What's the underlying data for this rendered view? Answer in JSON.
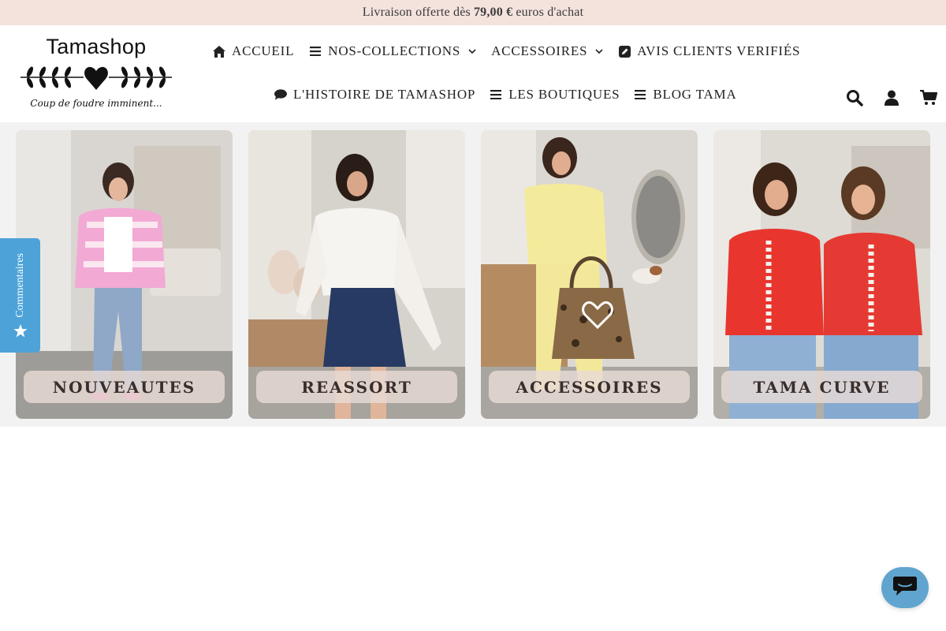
{
  "announcement": {
    "prefix": "Livraison offerte dès",
    "amount": "79,00 €",
    "suffix": "euros d'achat"
  },
  "logo": {
    "title": "Tamashop",
    "tagline": "Coup de foudre imminent..."
  },
  "nav": {
    "row1": [
      {
        "label": "ACCUEIL",
        "icon": "home-icon"
      },
      {
        "label": "NOS-COLLECTIONS",
        "icon": "bars-icon",
        "dropdown": true
      },
      {
        "label": "ACCESSOIRES",
        "dropdown": true
      },
      {
        "label": "AVIS CLIENTS VERIFIÉS",
        "icon": "edit-icon"
      }
    ],
    "row2": [
      {
        "label": "L'HISTOIRE DE TAMASHOP",
        "icon": "comment-icon"
      },
      {
        "label": "LES BOUTIQUES",
        "icon": "bars-icon"
      },
      {
        "label": "BLOG TAMA",
        "icon": "bars-icon"
      }
    ]
  },
  "header_icons": [
    "search-icon",
    "account-icon",
    "cart-icon"
  ],
  "collections": [
    {
      "label": "NOUVEAUTES"
    },
    {
      "label": "REASSORT"
    },
    {
      "label": "ACCESSOIRES"
    },
    {
      "label": "TAMA CURVE"
    }
  ],
  "reviews_tab": {
    "label": "Commentaires",
    "icon": "star-icon"
  },
  "chat": {
    "icon": "chat-icon"
  },
  "colors": {
    "announcement_bg": "#f4e3dd",
    "reviews_tab": "#4da3d8",
    "chat_bubble": "#5fa5cf"
  }
}
